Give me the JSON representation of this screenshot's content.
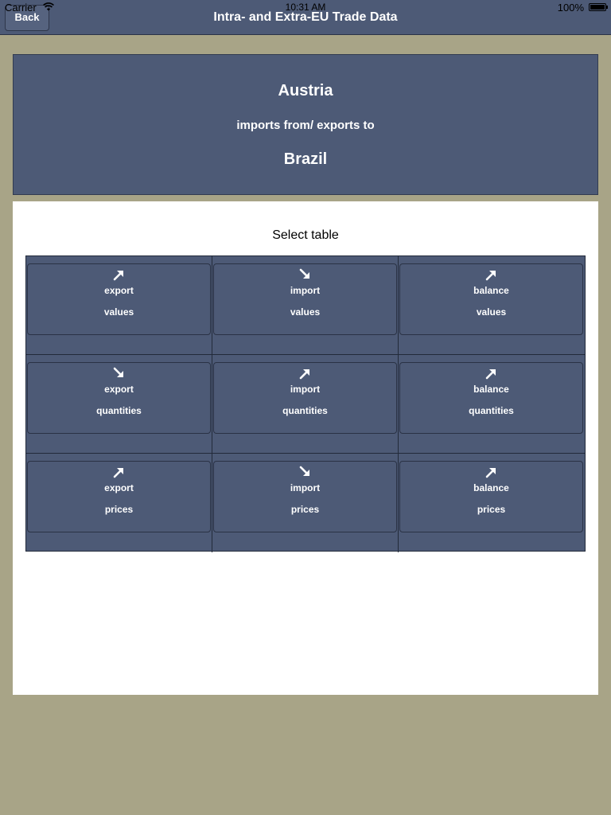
{
  "status_bar": {
    "carrier": "Carrier",
    "time": "10:31 AM",
    "battery": "100%"
  },
  "nav": {
    "back_label": "Back",
    "title": "Intra- and Extra-EU Trade Data"
  },
  "header": {
    "country_from": "Austria",
    "relation": "imports from/ exports to",
    "country_to": "Brazil"
  },
  "select_title": "Select table",
  "tiles": [
    {
      "line1": "export",
      "line2": "values",
      "arrow": "arrow-up-right-icon"
    },
    {
      "line1": "import",
      "line2": "values",
      "arrow": "arrow-down-right-icon"
    },
    {
      "line1": "balance",
      "line2": "values",
      "arrow": "arrow-up-right-icon"
    },
    {
      "line1": "export",
      "line2": "quantities",
      "arrow": "arrow-down-right-icon"
    },
    {
      "line1": "import",
      "line2": "quantities",
      "arrow": "arrow-up-right-icon"
    },
    {
      "line1": "balance",
      "line2": "quantities",
      "arrow": "arrow-up-right-icon"
    },
    {
      "line1": "export",
      "line2": "prices",
      "arrow": "arrow-up-right-icon"
    },
    {
      "line1": "import",
      "line2": "prices",
      "arrow": "arrow-down-right-icon"
    },
    {
      "line1": "balance",
      "line2": "prices",
      "arrow": "arrow-up-right-icon"
    }
  ],
  "colors": {
    "background": "#a8a487",
    "panel": "#4d5a76",
    "white": "#ffffff"
  }
}
